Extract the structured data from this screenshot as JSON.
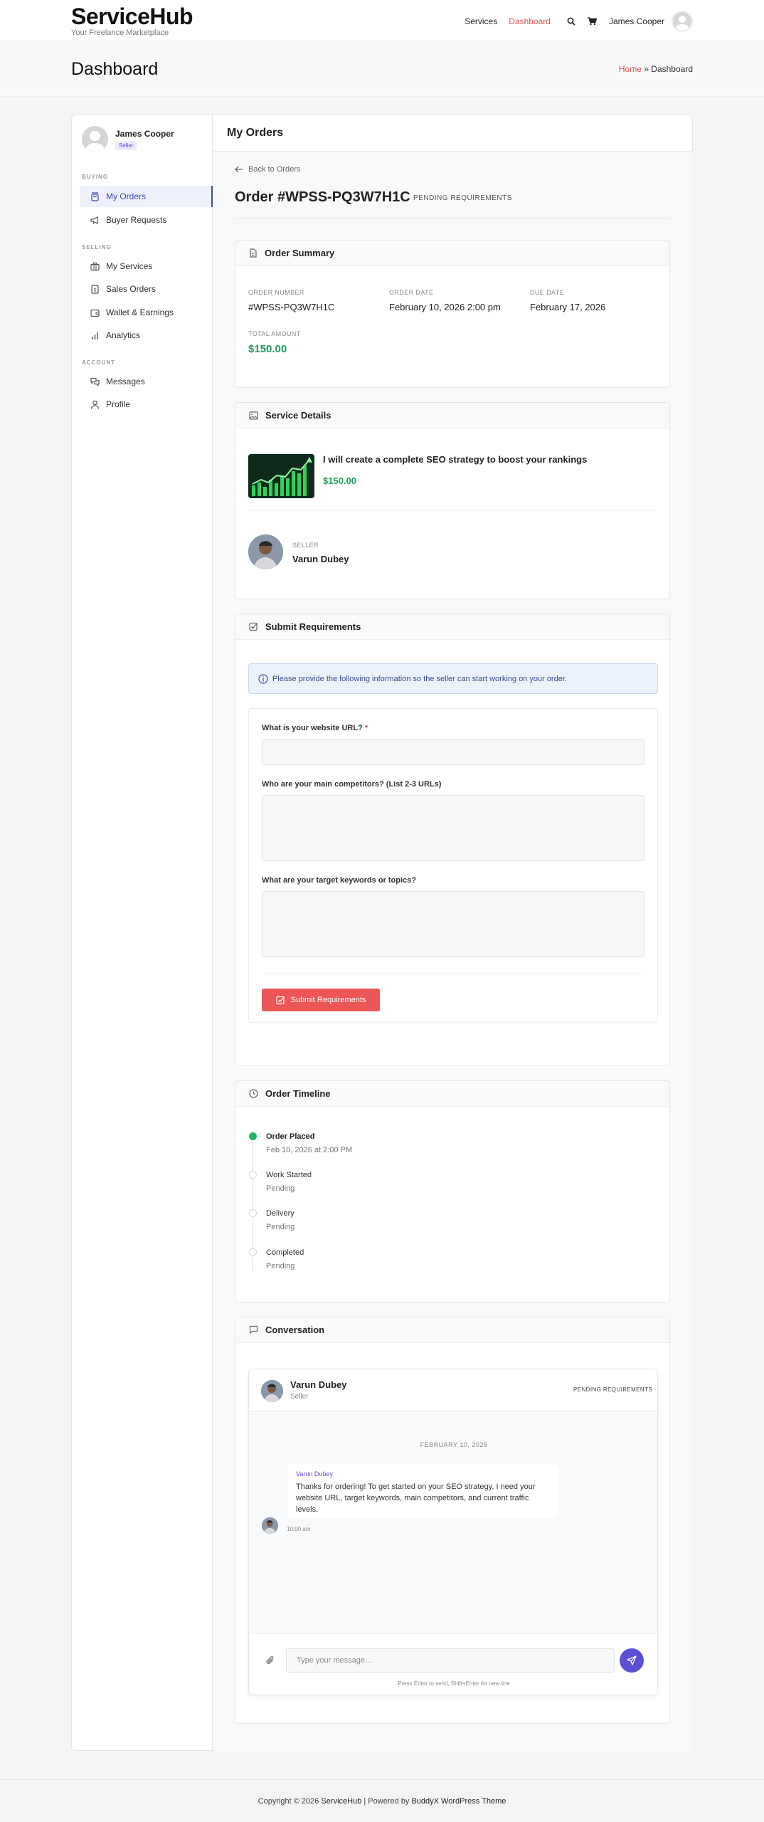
{
  "header": {
    "logo": "ServiceHub",
    "tagline": "Your Freelance Marketplace",
    "nav": {
      "services": "Services",
      "dashboard": "Dashboard"
    },
    "user_name": "James Cooper",
    "icons": [
      "search-icon",
      "cart-icon",
      "user-avatar"
    ]
  },
  "page": {
    "title": "Dashboard",
    "breadcrumb_home": "Home",
    "breadcrumb_sep": "»",
    "breadcrumb_current": "Dashboard"
  },
  "sidebar": {
    "user_name": "James Cooper",
    "role_badge": "Seller",
    "sections": {
      "buying": "BUYING",
      "selling": "SELLING",
      "account": "ACCOUNT"
    },
    "items": [
      {
        "label": "My Orders",
        "icon": "bag-icon",
        "active": true
      },
      {
        "label": "Buyer Requests",
        "icon": "megaphone-icon"
      },
      {
        "label": "My Services",
        "icon": "briefcase-icon"
      },
      {
        "label": "Sales Orders",
        "icon": "receipt-icon"
      },
      {
        "label": "Wallet & Earnings",
        "icon": "wallet-icon"
      },
      {
        "label": "Analytics",
        "icon": "bar-chart-icon"
      },
      {
        "label": "Messages",
        "icon": "chat-icon"
      },
      {
        "label": "Profile",
        "icon": "user-icon"
      }
    ]
  },
  "main": {
    "title": "My Orders",
    "back_label": "Back to Orders",
    "order_title": "Order #WPSS-PQ3W7H1C",
    "order_status": "PENDING REQUIREMENTS"
  },
  "summary": {
    "heading": "Order Summary",
    "order_number_label": "ORDER NUMBER",
    "order_number": "#WPSS-PQ3W7H1C",
    "order_date_label": "ORDER DATE",
    "order_date": "February 10, 2026 2:00 pm",
    "due_date_label": "DUE DATE",
    "due_date": "February 17, 2026",
    "total_label": "TOTAL AMOUNT",
    "total": "$150.00"
  },
  "service": {
    "heading": "Service Details",
    "title": "I will create a complete SEO strategy to boost your rankings",
    "price": "$150.00",
    "seller_label": "SELLER",
    "seller_name": "Varun Dubey"
  },
  "requirements": {
    "heading": "Submit Requirements",
    "info": "Please provide the following information so the seller can start working on your order.",
    "q1": "What is your website URL?",
    "q1_required": "*",
    "q2": "Who are your main competitors? (List 2-3 URLs)",
    "q3": "What are your target keywords or topics?",
    "submit_label": "Submit Requirements"
  },
  "timeline": {
    "heading": "Order Timeline",
    "steps": [
      {
        "title": "Order Placed",
        "sub": "Feb 10, 2026 at 2:00 PM",
        "done": true
      },
      {
        "title": "Work Started",
        "sub": "Pending",
        "done": false
      },
      {
        "title": "Delivery",
        "sub": "Pending",
        "done": false
      },
      {
        "title": "Completed",
        "sub": "Pending",
        "done": false
      }
    ]
  },
  "conversation": {
    "heading": "Conversation",
    "contact_name": "Varun Dubey",
    "contact_role": "Seller",
    "status": "PENDING REQUIREMENTS",
    "date_divider": "FEBRUARY 10, 2025",
    "message_sender": "Varun Dubey",
    "message_text": "Thanks for ordering! To get started on your SEO strategy, I need your website URL, target keywords, main competitors, and current traffic levels.",
    "message_time": "10:00 am",
    "input_placeholder": "Type your message...",
    "hint": "Press Enter to send, Shift+Enter for new line"
  },
  "footer": {
    "copyright": "Copyright © 2026",
    "site": "ServiceHub",
    "sep": "| Powered by",
    "theme": "BuddyX WordPress Theme"
  },
  "colors": {
    "accent_red": "#d9534f",
    "button_red": "#ec5656",
    "price_green": "#1b9e5c",
    "primary_purple": "#5b4fd6",
    "active_blue": "#3b4aa9"
  }
}
